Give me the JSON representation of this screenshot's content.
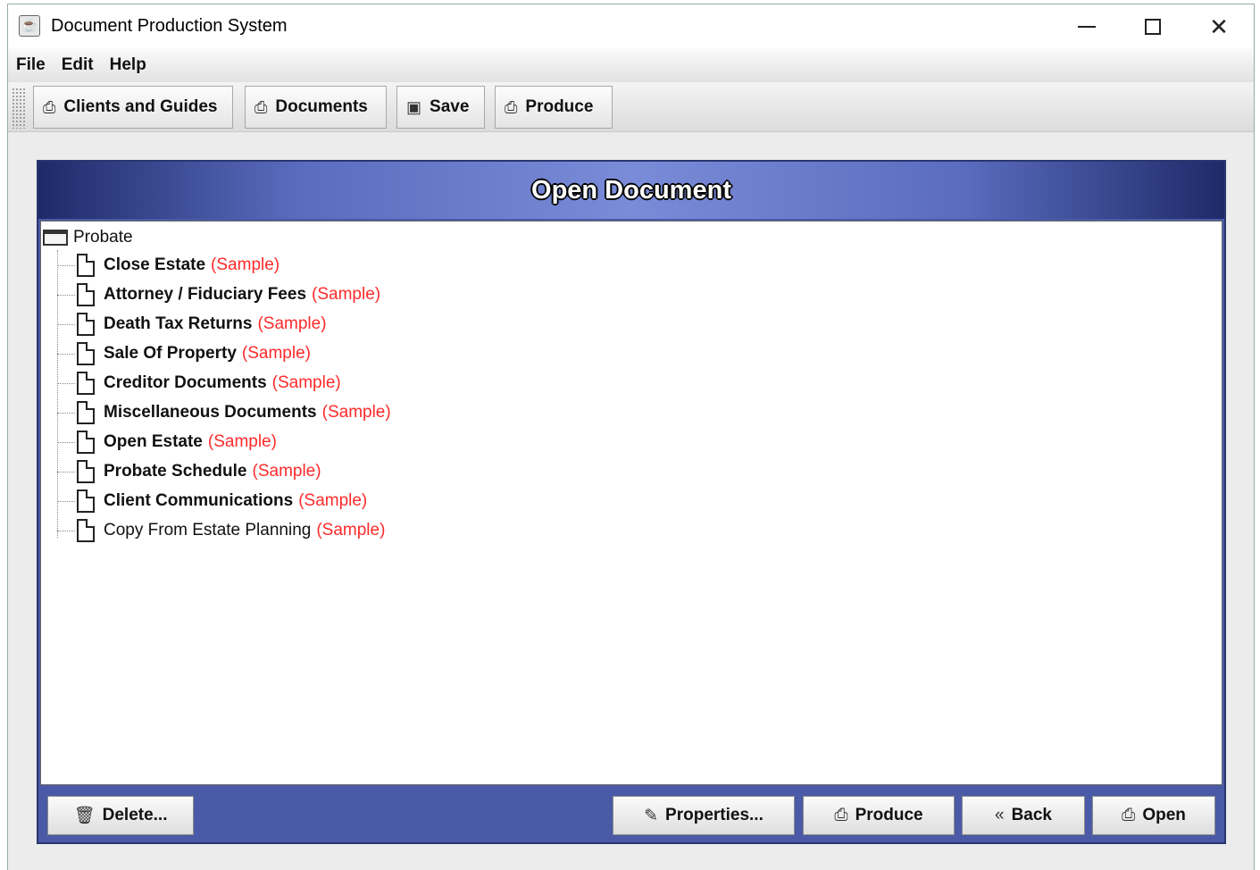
{
  "window": {
    "title": "Document Production System",
    "app_icon": "java-icon"
  },
  "menu": [
    "File",
    "Edit",
    "Help"
  ],
  "toolbar": {
    "clients_label": "Clients and Guides",
    "documents_label": "Documents",
    "save_label": "Save",
    "produce_label": "Produce"
  },
  "panel": {
    "title": "Open Document",
    "root": "Probate",
    "documents": [
      {
        "name": "Close Estate",
        "tag": "(Sample)",
        "bold": true
      },
      {
        "name": "Attorney / Fiduciary Fees",
        "tag": "(Sample)",
        "bold": true
      },
      {
        "name": "Death Tax Returns",
        "tag": "(Sample)",
        "bold": true
      },
      {
        "name": "Sale Of Property",
        "tag": "(Sample)",
        "bold": true
      },
      {
        "name": "Creditor Documents",
        "tag": "(Sample)",
        "bold": true
      },
      {
        "name": "Miscellaneous Documents",
        "tag": "(Sample)",
        "bold": true
      },
      {
        "name": "Open Estate",
        "tag": "(Sample)",
        "bold": true
      },
      {
        "name": "Probate Schedule",
        "tag": "(Sample)",
        "bold": true
      },
      {
        "name": "Client Communications",
        "tag": "(Sample)",
        "bold": true
      },
      {
        "name": "Copy From Estate Planning",
        "tag": "(Sample)",
        "bold": false
      }
    ]
  },
  "buttons": {
    "delete": "Delete...",
    "properties": "Properties...",
    "produce": "Produce",
    "back": "Back",
    "open": "Open"
  },
  "colors": {
    "panel_blue": "#4a5aa6",
    "sample_red": "#ff2a2a"
  }
}
